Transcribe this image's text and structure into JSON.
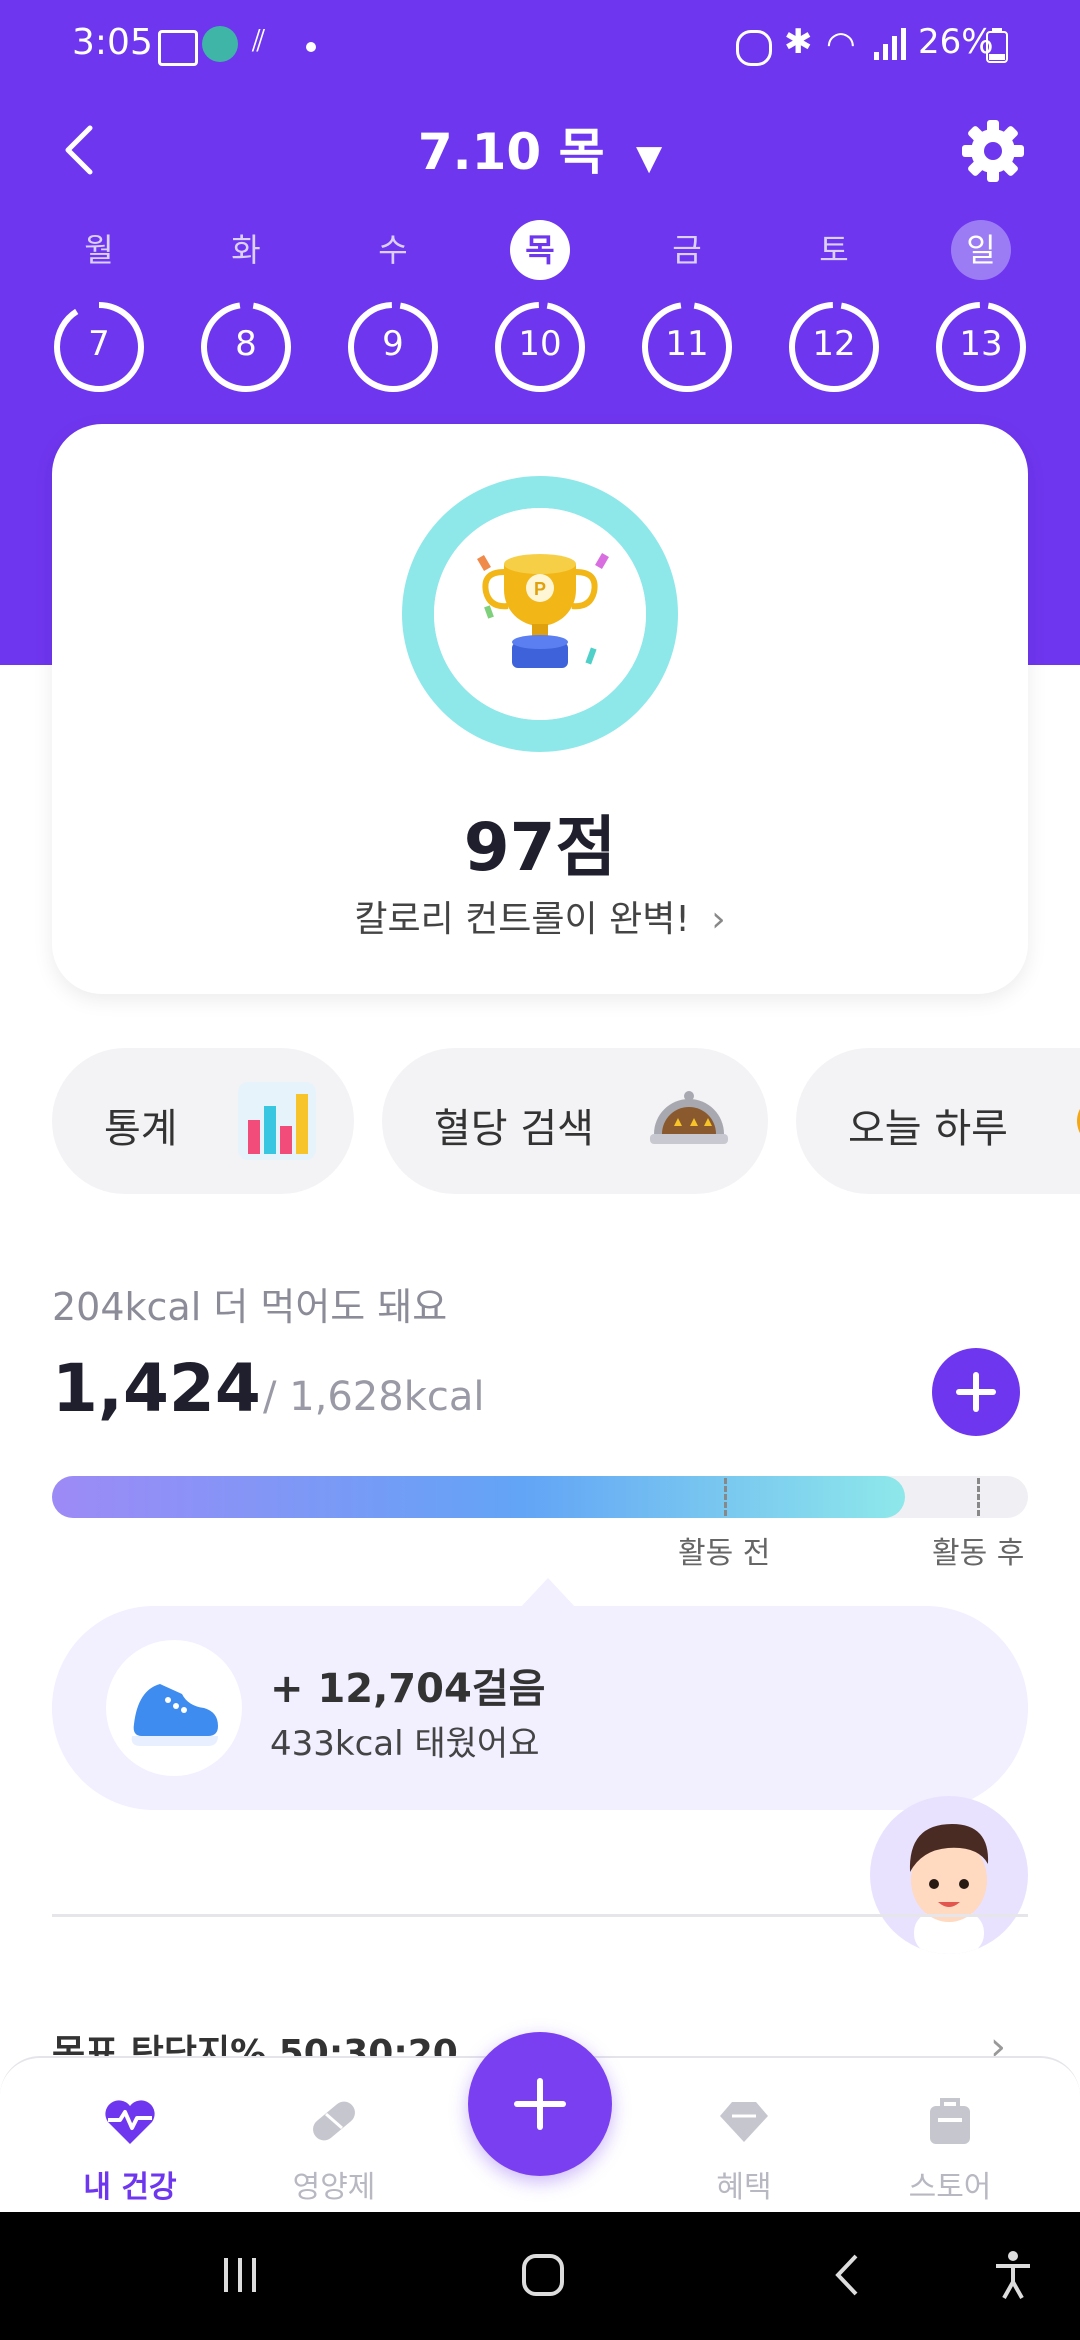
{
  "status_bar": {
    "time": "3:05",
    "battery": "26%"
  },
  "header": {
    "date_title": "7.10 목"
  },
  "week": [
    {
      "label": "월",
      "day": "7",
      "state": "normal"
    },
    {
      "label": "화",
      "day": "8",
      "state": "normal"
    },
    {
      "label": "수",
      "day": "9",
      "state": "normal"
    },
    {
      "label": "목",
      "day": "10",
      "state": "selected"
    },
    {
      "label": "금",
      "day": "11",
      "state": "normal"
    },
    {
      "label": "토",
      "day": "12",
      "state": "normal"
    },
    {
      "label": "일",
      "day": "13",
      "state": "sunday"
    }
  ],
  "score": {
    "value": "97점",
    "message": "칼로리 컨트롤이 완벽!"
  },
  "quick_menu": [
    {
      "label": "통계",
      "icon": "bar-chart-icon"
    },
    {
      "label": "혈당 검색",
      "icon": "food-tray-icon"
    },
    {
      "label": "오늘 하루",
      "icon": "today-icon"
    }
  ],
  "calories": {
    "remaining_text": "204kcal 더 먹어도 돼요",
    "consumed": "1,424",
    "goal": "/ 1,628kcal",
    "progress_fraction": 0.874,
    "before_activity_label": "활동 전",
    "after_activity_label": "활동 후"
  },
  "steps": {
    "count": "+ 12,704걸음",
    "burned": "433kcal 태웠어요"
  },
  "goal_section": {
    "text": "목표 탄단지% 50:30:20"
  },
  "bottom_nav": {
    "health": "내 건강",
    "supplements": "영양제",
    "benefits": "혜택",
    "store": "스토어"
  },
  "colors": {
    "brand": "#6f36ef",
    "score_ring": "#8ee8ea"
  }
}
